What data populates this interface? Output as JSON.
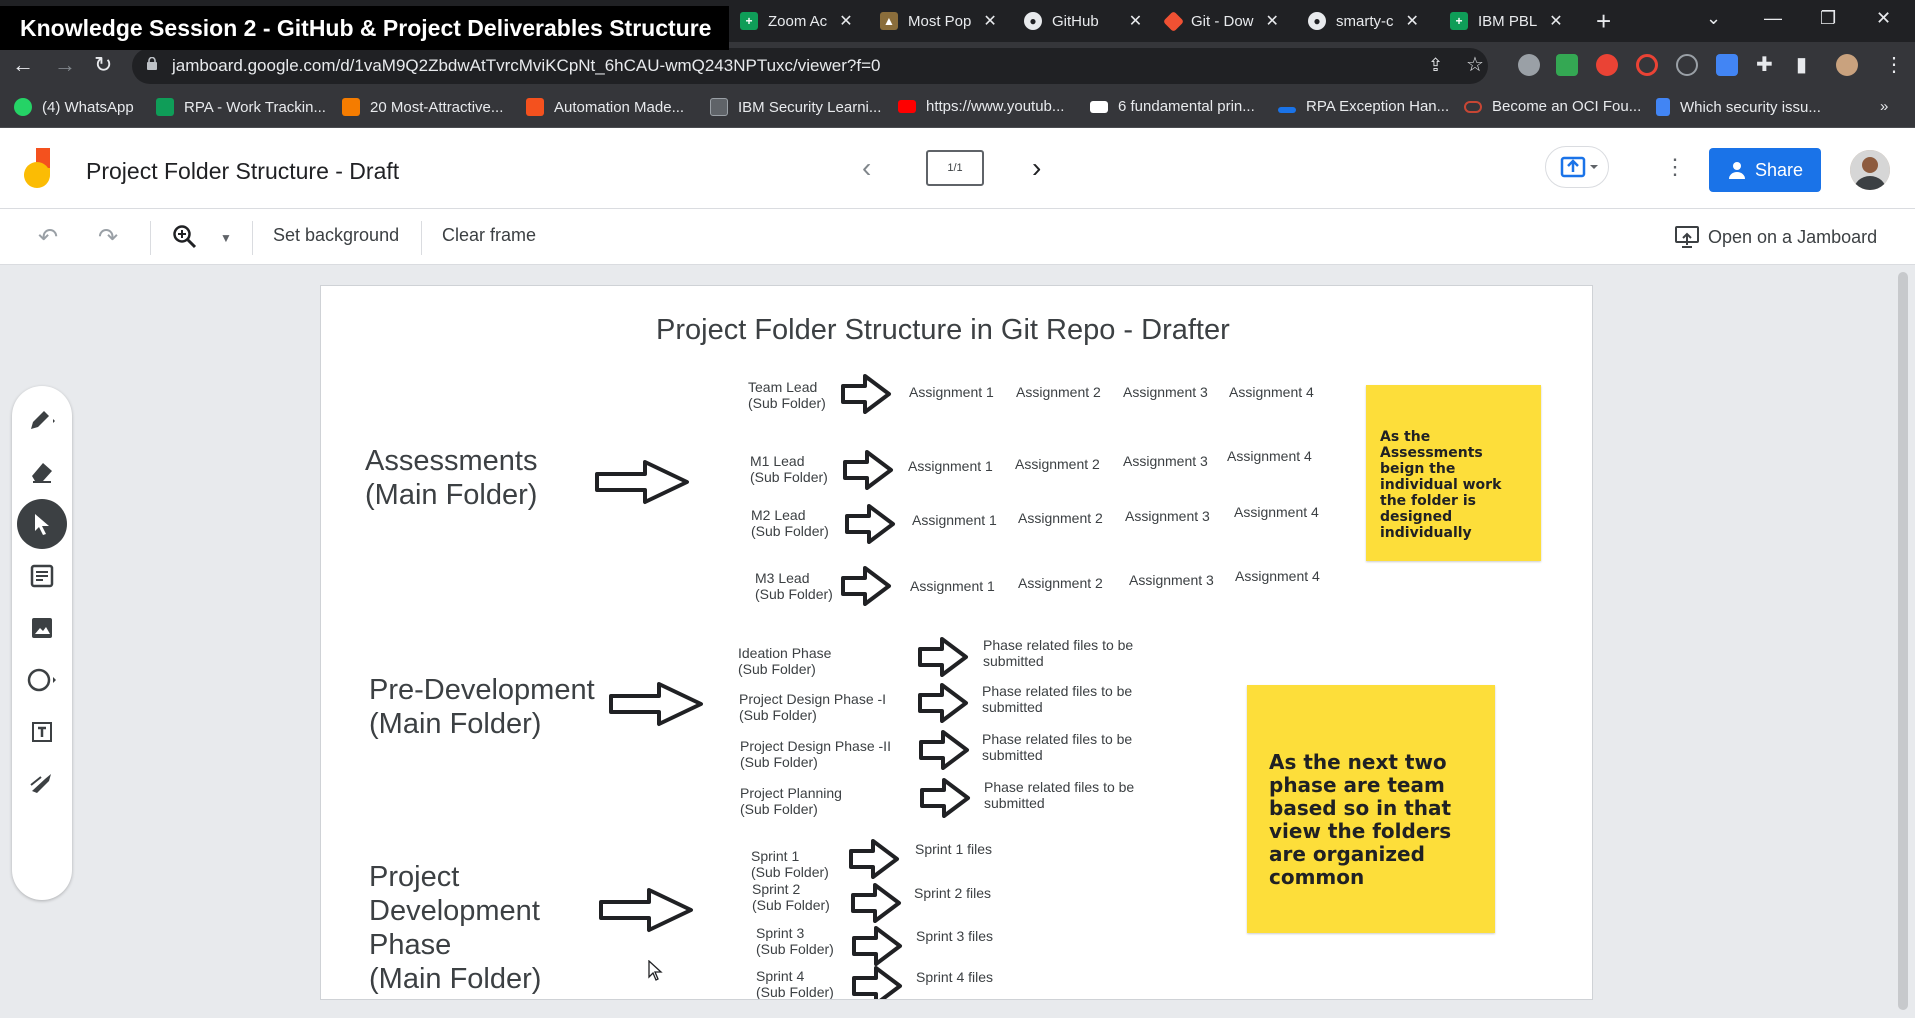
{
  "browser": {
    "session_title": "Knowledge Session 2 - GitHub & Project Deliverables Structure",
    "tabs": [
      {
        "title": "Zoom Ac",
        "icon": "sheets-icon",
        "color": "#0f9d58"
      },
      {
        "title": "Most Pop",
        "icon": "image-icon",
        "color": "#8a6d3b"
      },
      {
        "title": "GitHub",
        "icon": "github-icon",
        "color": "#e8eaed"
      },
      {
        "title": "Git - Dow",
        "icon": "git-icon",
        "color": "#f05133"
      },
      {
        "title": "smarty-c",
        "icon": "github-icon",
        "color": "#e8eaed"
      },
      {
        "title": "IBM PBL",
        "icon": "sheets-icon",
        "color": "#0f9d58"
      }
    ],
    "url": "jamboard.google.com/d/1vaM9Q2ZbdwAtTvrcMviKCpNt_6hCAU-wmQ243NPTuxc/viewer?f=0",
    "bookmarks": [
      {
        "label": "(4) WhatsApp",
        "color": "#25d366"
      },
      {
        "label": "RPA - Work Trackin...",
        "color": "#0f9d58"
      },
      {
        "label": "20 Most-Attractive...",
        "color": "#f57c00"
      },
      {
        "label": "Automation Made...",
        "color": "#f4511e"
      },
      {
        "label": "IBM Security Learni...",
        "color": "#9aa0a6"
      },
      {
        "label": "https://www.youtub...",
        "color": "#ff0000"
      },
      {
        "label": "6 fundamental prin...",
        "color": "#ffffff"
      },
      {
        "label": "RPA Exception Han...",
        "color": "#1a73e8"
      },
      {
        "label": "Become an OCI Fou...",
        "color": "#c74634"
      },
      {
        "label": "Which security issu...",
        "color": "#4285f4"
      }
    ],
    "more_bookmarks": "»"
  },
  "app": {
    "doc_title": "Project Folder Structure - Draft",
    "frame_counter": "1/1",
    "share_label": "Share",
    "accent": "#1a73e8"
  },
  "toolbar": {
    "set_background": "Set background",
    "clear_frame": "Clear frame",
    "open_on_jamboard": "Open on a Jamboard"
  },
  "frame": {
    "title": "Project Folder Structure in Git Repo - Drafter",
    "assessments": {
      "main_folder": [
        "Assessments",
        "(Main Folder)"
      ],
      "rows": [
        {
          "lead": [
            "Team Lead",
            "(Sub Folder)"
          ],
          "assignments": [
            "Assignment 1",
            "Assignment 2",
            "Assignment 3",
            "Assignment 4"
          ]
        },
        {
          "lead": [
            "M1 Lead",
            "(Sub Folder)"
          ],
          "assignments": [
            "Assignment 1",
            "Assignment 2",
            "Assignment 3",
            "Assignment 4"
          ]
        },
        {
          "lead": [
            "M2 Lead",
            "(Sub Folder)"
          ],
          "assignments": [
            "Assignment 1",
            "Assignment 2",
            "Assignment 3",
            "Assignment 4"
          ]
        },
        {
          "lead": [
            "M3 Lead",
            "(Sub Folder)"
          ],
          "assignments": [
            "Assignment 1",
            "Assignment 2",
            "Assignment 3",
            "Assignment 4"
          ]
        }
      ],
      "note": "As the Assessments beign the individual work the folder is designed individually"
    },
    "pre_development": {
      "main_folder": [
        "Pre-Development",
        "(Main Folder)"
      ],
      "rows": [
        {
          "phase": [
            "Ideation Phase",
            "(Sub Folder)"
          ],
          "files": [
            "Phase related files to be",
            "submitted"
          ]
        },
        {
          "phase": [
            "Project Design Phase -I",
            "(Sub Folder)"
          ],
          "files": [
            "Phase related files to be",
            "submitted"
          ]
        },
        {
          "phase": [
            "Project Design Phase -II",
            "(Sub Folder)"
          ],
          "files": [
            "Phase related files to be",
            "submitted"
          ]
        },
        {
          "phase": [
            "Project Planning",
            "(Sub Folder)"
          ],
          "files": [
            "Phase related files to be",
            "submitted"
          ]
        }
      ],
      "note": "As the next two phase are team based so in that view the folders are organized common"
    },
    "project_development": {
      "main_folder": [
        "Project",
        "Development",
        "Phase",
        "(Main Folder)"
      ],
      "rows": [
        {
          "sprint": [
            "Sprint 1",
            "(Sub Folder)"
          ],
          "files": "Sprint 1 files"
        },
        {
          "sprint": [
            "Sprint 2",
            "(Sub Folder)"
          ],
          "files": "Sprint 2 files"
        },
        {
          "sprint": [
            "Sprint 3",
            "(Sub Folder)"
          ],
          "files": "Sprint 3 files"
        },
        {
          "sprint": [
            "Sprint 4",
            "(Sub Folder)"
          ],
          "files": "Sprint 4 files"
        }
      ]
    },
    "sticky_color": "#fdde3a"
  }
}
